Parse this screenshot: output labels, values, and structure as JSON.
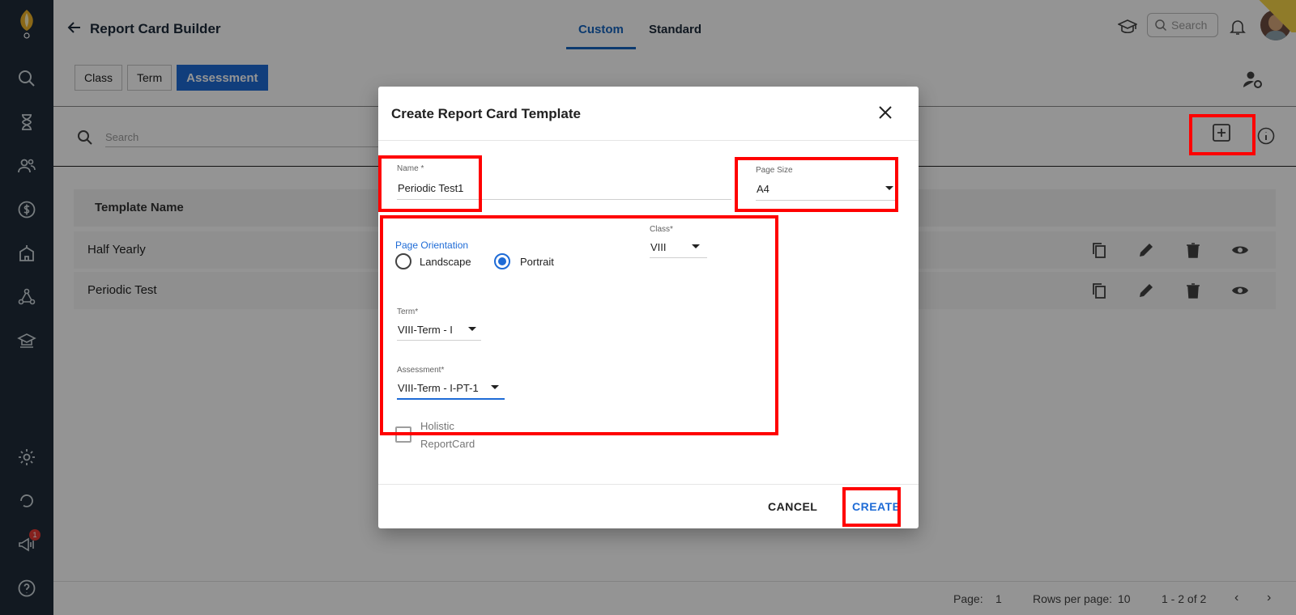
{
  "header": {
    "title": "Report Card Builder",
    "tabs": [
      "Custom",
      "Standard"
    ],
    "search_placeholder": "Search"
  },
  "sidebar": {
    "notification_count": "1",
    "icons": [
      "search-icon",
      "hourglass-icon",
      "people-icon",
      "dollar-icon",
      "school-icon",
      "network-icon",
      "academic-icon",
      "gear-icon",
      "refresh-icon",
      "megaphone-icon",
      "help-icon"
    ]
  },
  "subnav": {
    "tabs": [
      "Class",
      "Term",
      "Assessment"
    ],
    "active": "Assessment"
  },
  "list": {
    "search_placeholder": "Search",
    "column_header": "Template Name",
    "rows": [
      "Half Yearly",
      "Periodic Test"
    ]
  },
  "footer": {
    "page_label": "Page:",
    "page_value": "1",
    "rows_label": "Rows per page:",
    "rows_value": "10",
    "range": "1 - 2 of 2"
  },
  "dialog": {
    "title": "Create Report Card Template",
    "name_label": "Name *",
    "name_value": "Periodic Test1",
    "page_size_label": "Page Size",
    "page_size_value": "A4",
    "orientation_label": "Page Orientation",
    "orientation_options": [
      "Landscape",
      "Portrait"
    ],
    "orientation_selected": "Portrait",
    "class_label": "Class*",
    "class_value": "VIII",
    "term_label": "Term*",
    "term_value": "VIII-Term - I",
    "assessment_label": "Assessment*",
    "assessment_value": "VIII-Term - I-PT-1",
    "holistic_label_1": "Holistic",
    "holistic_label_2": "ReportCard",
    "cancel_label": "CANCEL",
    "create_label": "CREATE"
  },
  "colors": {
    "primary": "#1e6bd6",
    "sidebar": "#1f2b3a",
    "highlight": "#ff0000"
  }
}
